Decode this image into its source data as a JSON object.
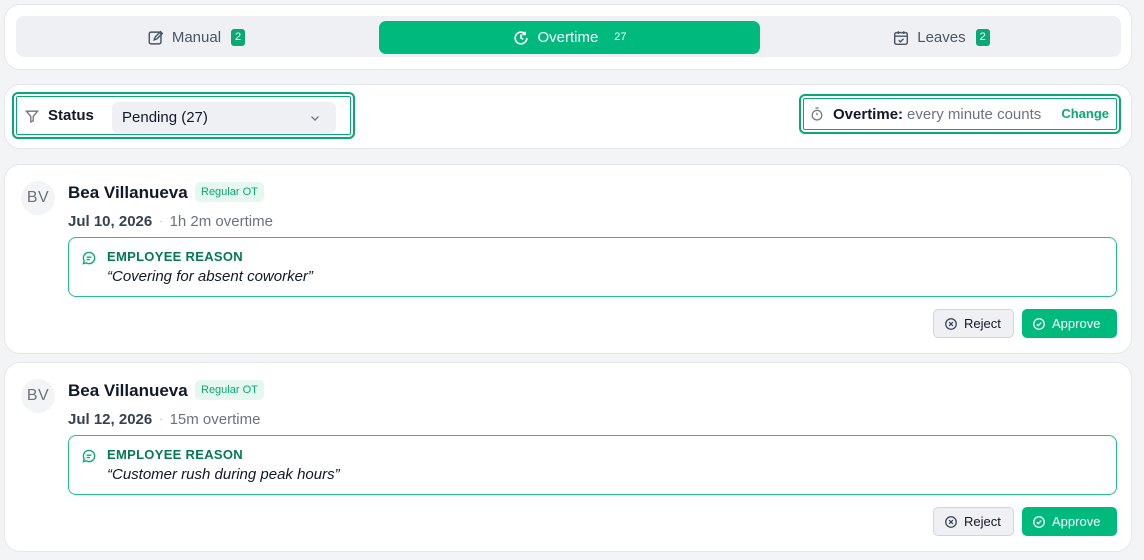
{
  "tabs": [
    {
      "label": "Manual",
      "count": "2",
      "icon": "edit-icon"
    },
    {
      "label": "Overtime",
      "count": "27",
      "icon": "clock-icon"
    },
    {
      "label": "Leaves",
      "count": "2",
      "icon": "calendar-icon"
    }
  ],
  "filter": {
    "status_label": "Status",
    "status_value": "Pending (27)"
  },
  "overtime_rule": {
    "label": "Overtime:",
    "value": "every minute counts",
    "change": "Change"
  },
  "requests": [
    {
      "initials": "BV",
      "name": "Bea Villanueva",
      "type": "Regular OT",
      "date": "Jul 10, 2026",
      "separator": "·",
      "duration": "1h 2m overtime",
      "reason_title": "EMPLOYEE REASON",
      "reason": "“Covering for absent coworker”",
      "reject": "Reject",
      "approve": "Approve"
    },
    {
      "initials": "BV",
      "name": "Bea Villanueva",
      "type": "Regular OT",
      "date": "Jul 12, 2026",
      "separator": "·",
      "duration": "15m overtime",
      "reason_title": "EMPLOYEE REASON",
      "reason": "“Customer rush during peak hours”",
      "reject": "Reject",
      "approve": "Approve"
    }
  ],
  "colors": {
    "accent": "#00b97c",
    "accent_dark": "#047a53",
    "background": "#f3f4f6"
  }
}
